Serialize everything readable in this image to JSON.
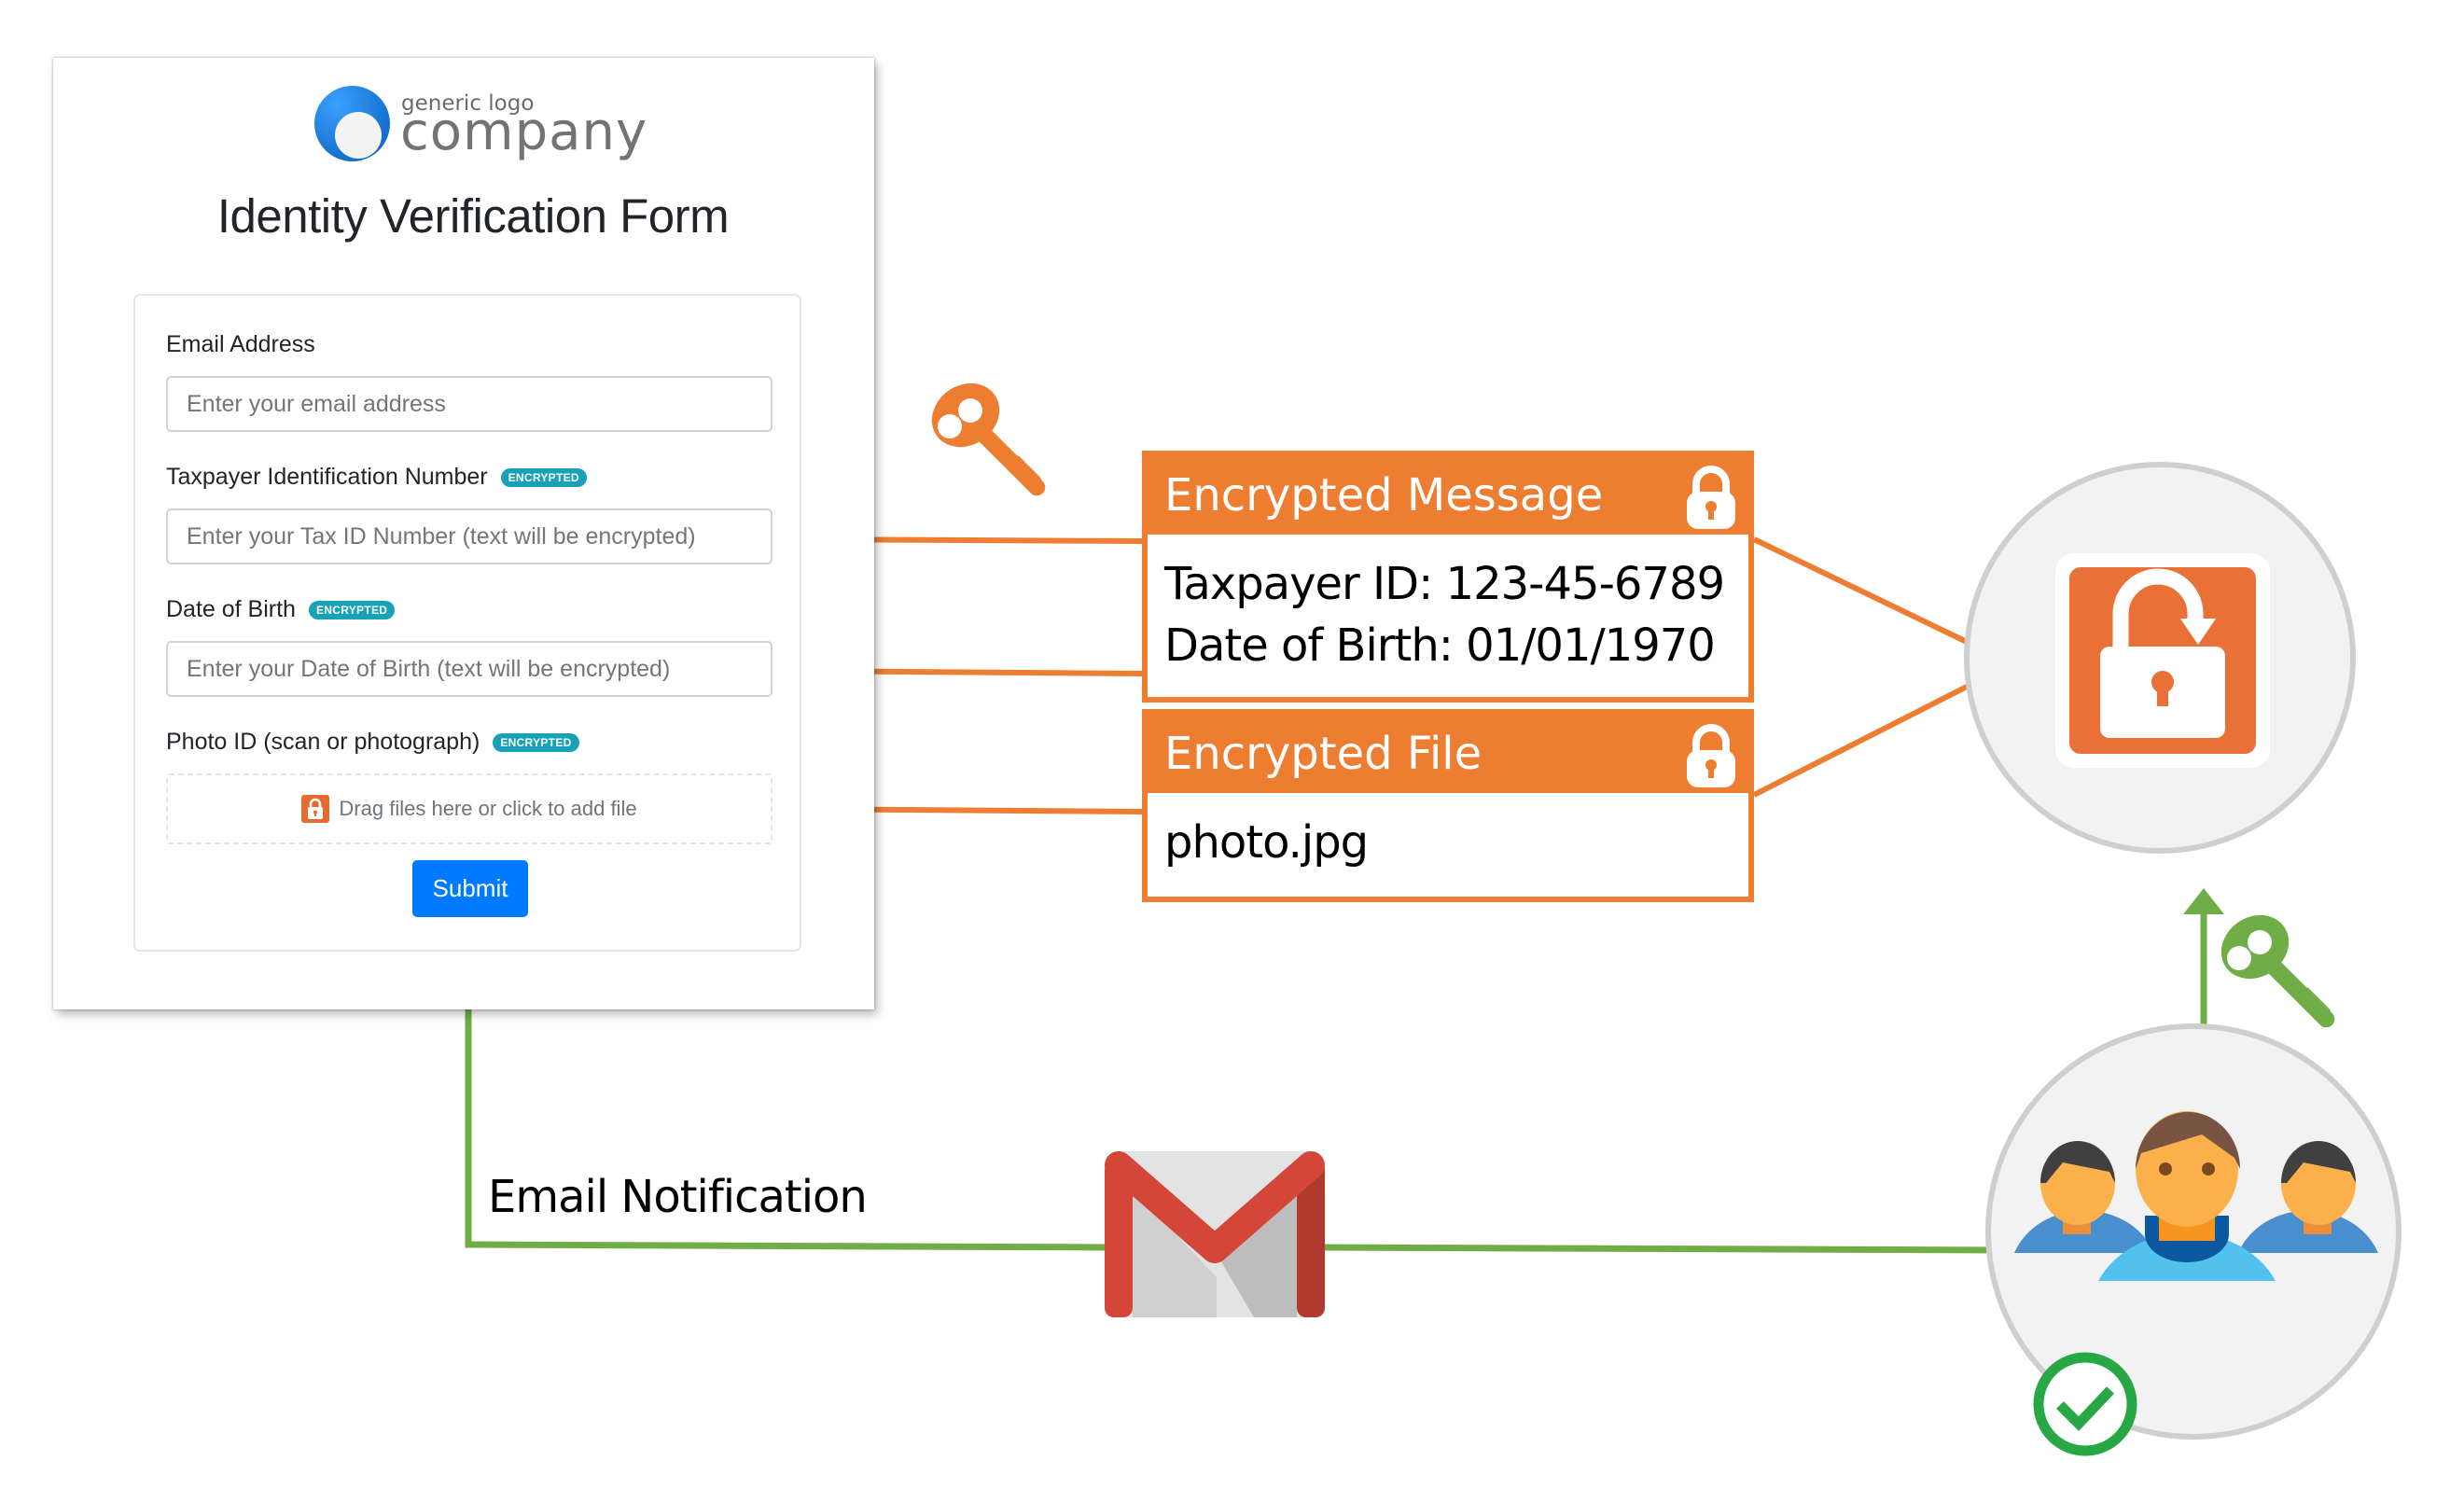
{
  "form": {
    "logo": {
      "small_text": "generic logo",
      "big_text": "company"
    },
    "title": "Identity Verification Form",
    "fields": [
      {
        "label": "Email Address",
        "badge": null,
        "placeholder": "Enter your email address"
      },
      {
        "label": "Taxpayer Identification Number",
        "badge": "ENCRYPTED",
        "placeholder": "Enter your Tax ID Number (text will be encrypted)"
      },
      {
        "label": "Date of Birth",
        "badge": "ENCRYPTED",
        "placeholder": "Enter your Date of Birth (text will be encrypted)"
      },
      {
        "label": "Photo ID (scan or photograph)",
        "badge": "ENCRYPTED",
        "dropzone_text": "Drag files here or click to add file"
      }
    ],
    "submit_label": "Submit"
  },
  "encrypted_message": {
    "title": "Encrypted Message",
    "lines": [
      "Taxpayer ID: 123-45-6789",
      "Date of Birth: 01/01/1970"
    ]
  },
  "encrypted_file": {
    "title": "Encrypted File",
    "filename": "photo.jpg"
  },
  "email_notification_label": "Email Notification",
  "icons": {
    "orange_key": "key-icon",
    "green_key": "key-icon",
    "unlock": "unlock-icon",
    "gmail": "gmail-icon",
    "users": "users-group-icon",
    "check": "check-circle-icon"
  },
  "colors": {
    "orange": "#ED7D31",
    "green": "#70AD47",
    "primary_blue": "#007BFF",
    "badge_teal": "#17A2B8",
    "check_green": "#28A745"
  }
}
